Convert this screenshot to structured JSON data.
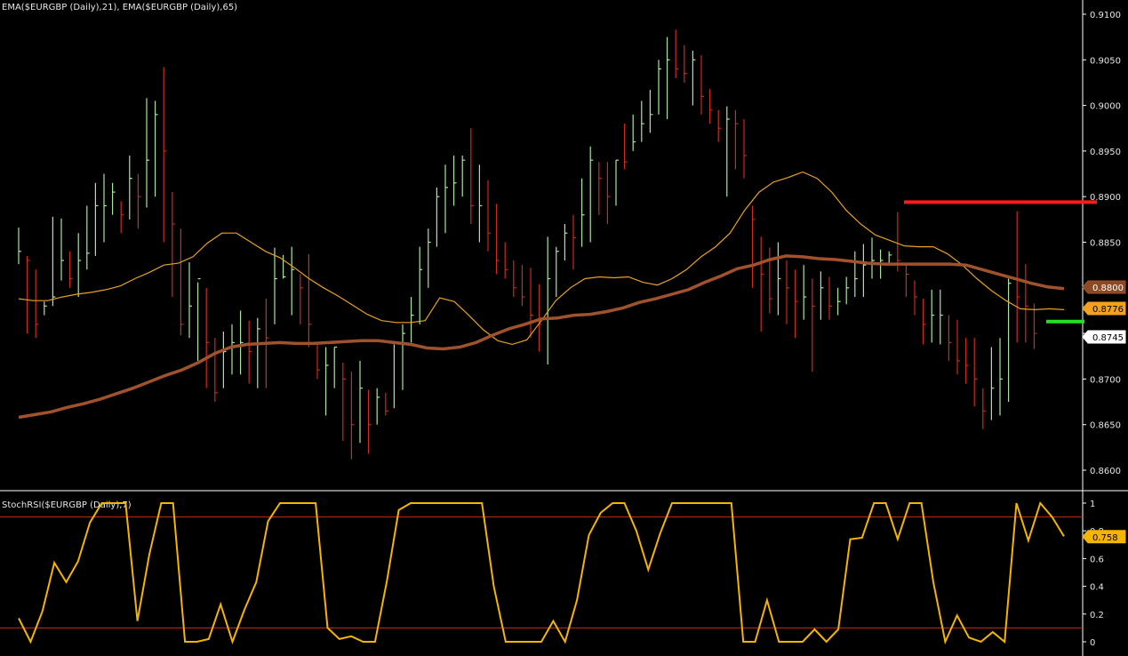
{
  "chart_data": [
    {
      "type": "ohlc",
      "title": "EMA($EURGBP (Daily),21), EMA($EURGBP (Daily),65)",
      "y_ticks": [
        "0.9100",
        "0.9050",
        "0.9000",
        "0.8950",
        "0.8900",
        "0.8850",
        "0.8800",
        "0.8750",
        "0.8700",
        "0.8650",
        "0.8600"
      ],
      "ylim": [
        0.8577,
        0.911
      ],
      "colors": {
        "up": "#a8e6a0",
        "down": "#cc2a1a",
        "ema21": "#e8a020",
        "ema65": "#a0522d",
        "resistance": "#ff1a1a",
        "support": "#22e022"
      },
      "bars": [
        [
          0.8866,
          0.8826,
          0.884
        ],
        [
          0.8835,
          0.875,
          0.883
        ],
        [
          0.882,
          0.8745,
          0.876
        ],
        [
          0.8785,
          0.877,
          0.878
        ],
        [
          0.8878,
          0.878,
          0.879
        ],
        [
          0.8876,
          0.8808,
          0.883
        ],
        [
          0.884,
          0.88,
          0.881
        ],
        [
          0.886,
          0.879,
          0.883
        ],
        [
          0.889,
          0.882,
          0.8838
        ],
        [
          0.8915,
          0.8835,
          0.889
        ],
        [
          0.8925,
          0.885,
          0.889
        ],
        [
          0.8915,
          0.888,
          0.8905
        ],
        [
          0.8895,
          0.886,
          0.888
        ],
        [
          0.8945,
          0.8875,
          0.892
        ],
        [
          0.8925,
          0.8865,
          0.89
        ],
        [
          0.9008,
          0.8888,
          0.894
        ],
        [
          0.9005,
          0.89,
          0.899
        ],
        [
          0.9042,
          0.885,
          0.895
        ],
        [
          0.8905,
          0.879,
          0.887
        ],
        [
          0.8865,
          0.8748,
          0.876
        ],
        [
          0.8828,
          0.8745,
          0.878
        ],
        [
          0.8806,
          0.872,
          0.881
        ],
        [
          0.88,
          0.869,
          0.874
        ],
        [
          0.8745,
          0.8675,
          0.8685
        ],
        [
          0.8752,
          0.869,
          0.873
        ],
        [
          0.876,
          0.8705,
          0.874
        ],
        [
          0.8775,
          0.8705,
          0.874
        ],
        [
          0.8764,
          0.8695,
          0.873
        ],
        [
          0.8767,
          0.869,
          0.8755
        ],
        [
          0.8788,
          0.869,
          0.8745
        ],
        [
          0.8844,
          0.876,
          0.881
        ],
        [
          0.8836,
          0.881,
          0.8812
        ],
        [
          0.8845,
          0.877,
          0.882
        ],
        [
          0.8815,
          0.876,
          0.88
        ],
        [
          0.8837,
          0.8735,
          0.876
        ],
        [
          0.874,
          0.87,
          0.871
        ],
        [
          0.8735,
          0.866,
          0.8715
        ],
        [
          0.8735,
          0.869,
          0.8735
        ],
        [
          0.8718,
          0.8632,
          0.87
        ],
        [
          0.8708,
          0.8612,
          0.865
        ],
        [
          0.872,
          0.863,
          0.869
        ],
        [
          0.8688,
          0.8618,
          0.865
        ],
        [
          0.869,
          0.865,
          0.868
        ],
        [
          0.8685,
          0.866,
          0.8665
        ],
        [
          0.8738,
          0.8668,
          0.874
        ],
        [
          0.876,
          0.8688,
          0.875
        ],
        [
          0.879,
          0.874,
          0.877
        ],
        [
          0.8845,
          0.876,
          0.882
        ],
        [
          0.8865,
          0.88,
          0.885
        ],
        [
          0.891,
          0.8845,
          0.89
        ],
        [
          0.8935,
          0.886,
          0.891
        ],
        [
          0.8945,
          0.889,
          0.8915
        ],
        [
          0.8945,
          0.89,
          0.894
        ],
        [
          0.8975,
          0.887,
          0.889
        ],
        [
          0.8935,
          0.885,
          0.889
        ],
        [
          0.8918,
          0.884,
          0.886
        ],
        [
          0.8892,
          0.8815,
          0.883
        ],
        [
          0.885,
          0.881,
          0.882
        ],
        [
          0.883,
          0.879,
          0.88
        ],
        [
          0.8825,
          0.878,
          0.879
        ],
        [
          0.8822,
          0.8745,
          0.877
        ],
        [
          0.8804,
          0.873,
          0.876
        ],
        [
          0.8856,
          0.8716,
          0.881
        ],
        [
          0.8845,
          0.879,
          0.884
        ],
        [
          0.887,
          0.883,
          0.886
        ],
        [
          0.888,
          0.882,
          0.8855
        ],
        [
          0.892,
          0.8845,
          0.888
        ],
        [
          0.8955,
          0.885,
          0.894
        ],
        [
          0.8938,
          0.888,
          0.892
        ],
        [
          0.8938,
          0.887,
          0.89
        ],
        [
          0.894,
          0.889,
          0.894
        ],
        [
          0.898,
          0.893,
          0.8938
        ],
        [
          0.899,
          0.895,
          0.896
        ],
        [
          0.9005,
          0.896,
          0.898
        ],
        [
          0.9017,
          0.897,
          0.899
        ],
        [
          0.905,
          0.899,
          0.904
        ],
        [
          0.9075,
          0.8985,
          0.905
        ],
        [
          0.9083,
          0.903,
          0.904
        ],
        [
          0.9066,
          0.9025,
          0.9035
        ],
        [
          0.906,
          0.9,
          0.905
        ],
        [
          0.9055,
          0.899,
          0.901
        ],
        [
          0.9018,
          0.898,
          0.8995
        ],
        [
          0.8995,
          0.896,
          0.8975
        ],
        [
          0.8999,
          0.89,
          0.8985
        ],
        [
          0.8995,
          0.893,
          0.898
        ],
        [
          0.8985,
          0.892,
          0.8945
        ],
        [
          0.889,
          0.88,
          0.8875
        ],
        [
          0.8856,
          0.8752,
          0.8815
        ],
        [
          0.8844,
          0.8772,
          0.8788
        ],
        [
          0.885,
          0.877,
          0.881
        ],
        [
          0.883,
          0.876,
          0.88
        ],
        [
          0.882,
          0.8745,
          0.8785
        ],
        [
          0.8825,
          0.8765,
          0.879
        ],
        [
          0.881,
          0.8708,
          0.878
        ],
        [
          0.8818,
          0.8765,
          0.88
        ],
        [
          0.8812,
          0.8765,
          0.878
        ],
        [
          0.88,
          0.877,
          0.8785
        ],
        [
          0.8812,
          0.8782,
          0.88
        ],
        [
          0.884,
          0.879,
          0.881
        ],
        [
          0.8848,
          0.879,
          0.8825
        ],
        [
          0.8855,
          0.881,
          0.883
        ],
        [
          0.8842,
          0.881,
          0.883
        ],
        [
          0.884,
          0.8825,
          0.8836
        ],
        [
          0.8883,
          0.8818,
          0.883
        ],
        [
          0.8826,
          0.879,
          0.8815
        ],
        [
          0.8808,
          0.877,
          0.879
        ],
        [
          0.8788,
          0.8738,
          0.876
        ],
        [
          0.8798,
          0.874,
          0.877
        ],
        [
          0.8798,
          0.8738,
          0.877
        ],
        [
          0.877,
          0.872,
          0.874
        ],
        [
          0.8765,
          0.8705,
          0.872
        ],
        [
          0.8745,
          0.8695,
          0.8715
        ],
        [
          0.8745,
          0.867,
          0.87
        ],
        [
          0.869,
          0.8645,
          0.8665
        ],
        [
          0.8735,
          0.8655,
          0.869
        ],
        [
          0.8745,
          0.866,
          0.87
        ],
        [
          0.881,
          0.8675,
          0.8805
        ],
        [
          0.8884,
          0.874,
          0.879
        ],
        [
          0.8826,
          0.874,
          0.878
        ],
        [
          0.8783,
          0.8733,
          0.875
        ]
      ],
      "ema21": [
        0.8788,
        0.8786,
        0.8786,
        0.879,
        0.8793,
        0.8795,
        0.8798,
        0.8802,
        0.881,
        0.8817,
        0.8825,
        0.8827,
        0.8834,
        0.8849,
        0.886,
        0.886,
        0.885,
        0.884,
        0.8833,
        0.8822,
        0.881,
        0.88,
        0.8791,
        0.8781,
        0.8771,
        0.8764,
        0.8762,
        0.8762,
        0.8764,
        0.8789,
        0.8785,
        0.877,
        0.8754,
        0.8742,
        0.8738,
        0.8743,
        0.8764,
        0.8786,
        0.88,
        0.881,
        0.8812,
        0.8811,
        0.8812,
        0.8806,
        0.8803,
        0.881,
        0.882,
        0.8834,
        0.8845,
        0.886,
        0.8885,
        0.8905,
        0.8916,
        0.8921,
        0.8927,
        0.892,
        0.8905,
        0.8885,
        0.887,
        0.8858,
        0.8852,
        0.8846,
        0.8845,
        0.8845,
        0.8837,
        0.8825,
        0.881,
        0.8797,
        0.8786,
        0.8777,
        0.8776,
        0.8777,
        0.8776
      ],
      "ema65": [
        0.8658,
        0.8661,
        0.8664,
        0.8669,
        0.8673,
        0.8678,
        0.8684,
        0.869,
        0.8697,
        0.8704,
        0.871,
        0.8718,
        0.8728,
        0.8735,
        0.8738,
        0.8739,
        0.874,
        0.8739,
        0.8739,
        0.874,
        0.8741,
        0.8742,
        0.8742,
        0.874,
        0.8738,
        0.8734,
        0.8733,
        0.8735,
        0.874,
        0.8748,
        0.8755,
        0.876,
        0.8766,
        0.8767,
        0.877,
        0.8771,
        0.8774,
        0.8778,
        0.8784,
        0.8788,
        0.8793,
        0.8798,
        0.8806,
        0.8813,
        0.8821,
        0.8825,
        0.8831,
        0.8835,
        0.8834,
        0.8832,
        0.8831,
        0.8829,
        0.8827,
        0.8826,
        0.8826,
        0.8826,
        0.8826,
        0.8826,
        0.8825,
        0.882,
        0.8815,
        0.881,
        0.8805,
        0.8801,
        0.8799
      ],
      "resistance_level": 0.8894,
      "support_level": 0.8763,
      "value_tags": [
        "0.8800",
        "0.8776",
        "0.8745"
      ]
    },
    {
      "type": "line",
      "title": "StochRSI($EURGBP (Daily),7)",
      "y_ticks": [
        "1",
        "0.8",
        "0.6",
        "0.4",
        "0.2",
        "0"
      ],
      "ylim": [
        0,
        1
      ],
      "reference_lines": [
        0.9,
        0.1
      ],
      "color": "#f4b400",
      "ref_color": "#c8281c",
      "values": [
        0.17,
        0.0,
        0.22,
        0.57,
        0.43,
        0.58,
        0.86,
        1.0,
        1.0,
        1.0,
        0.15,
        0.63,
        1.0,
        1.0,
        0.0,
        0.0,
        0.02,
        0.27,
        0.0,
        0.23,
        0.43,
        0.87,
        1.0,
        1.0,
        1.0,
        1.0,
        0.1,
        0.02,
        0.04,
        0.0,
        0.0,
        0.44,
        0.95,
        1.0,
        1.0,
        1.0,
        1.0,
        1.0,
        1.0,
        1.0,
        0.4,
        0.0,
        0.0,
        0.0,
        0.0,
        0.15,
        0.0,
        0.3,
        0.77,
        0.93,
        1.0,
        1.0,
        0.8,
        0.52,
        0.78,
        1.0,
        1.0,
        1.0,
        1.0,
        1.0,
        1.0,
        0.0,
        0.0,
        0.3,
        0.0,
        0.0,
        0.0,
        0.09,
        0.0,
        0.09,
        0.74,
        0.75,
        1.0,
        1.0,
        0.74,
        1.0,
        1.0,
        0.43,
        0.0,
        0.19,
        0.03,
        0.0,
        0.07,
        0.0,
        1.0,
        0.73,
        1.0,
        0.9,
        0.76
      ],
      "value_tag": "0.758"
    }
  ]
}
